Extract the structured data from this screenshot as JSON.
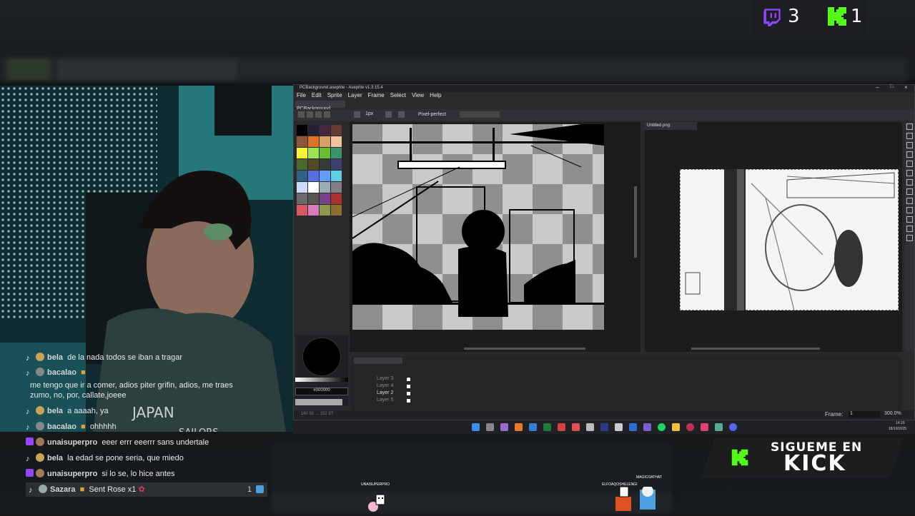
{
  "counters": {
    "twitch": "3",
    "kick": "1"
  },
  "aseprite": {
    "title": "PCBackground.aseprite - Aseprite v1.3.15.4",
    "menu": [
      "File",
      "Edit",
      "Sprite",
      "Layer",
      "Frame",
      "Select",
      "View",
      "Help"
    ],
    "tab_main": "PCBackground.",
    "tab_ref": "Untitled.png",
    "brush_size": "1px",
    "pixel_perfect": "Pixel-perfect",
    "color_hex": "#000000",
    "layers": [
      "Layer 3",
      "Layer 4",
      "Layer 2",
      "Layer 5"
    ],
    "status_coords": "160 91  ...  152 97",
    "frame_label": "Frame:",
    "frame_value": "1",
    "zoom": "300.0%",
    "clock_time": "14:29",
    "clock_date": "18/10/2025"
  },
  "chat": [
    {
      "platform": "tiktok",
      "user": "bela",
      "text": "de la nada todos se iban a tragar"
    },
    {
      "platform": "tiktok",
      "user": "bacalao",
      "text": ""
    },
    {
      "platform": "none",
      "user": "",
      "text": "me tengo que ir a comer, adios piter grifin, adios, me traes"
    },
    {
      "platform": "none",
      "user": "",
      "text": "zumo, no, por, callate,joeee"
    },
    {
      "platform": "tiktok",
      "user": "bela",
      "text": "a aaaah, ya"
    },
    {
      "platform": "tiktok",
      "user": "bacalao",
      "text": "ohhhhh"
    },
    {
      "platform": "twitch",
      "user": "unaisuperpro",
      "text": "eeer errr eeerrr sans undertale"
    },
    {
      "platform": "tiktok",
      "user": "bela",
      "text": "la edad se pone seria, que miedo"
    },
    {
      "platform": "twitch",
      "user": "unaisuperpro",
      "text": "si lo se, lo hice antes"
    },
    {
      "platform": "tiktok",
      "user": "Sazara",
      "text": "Sent Rose x1",
      "gift_count": "1"
    }
  ],
  "overlay": {
    "kick_line1": "SIGUEME EN",
    "kick_line2": "KICK",
    "char1_name": "UNAISUPERPRO",
    "char2_name": "ELFOAQOSHELENGI",
    "char3_name": "MAGICOATHAT"
  },
  "colors": {
    "kick_green": "#53fc18",
    "twitch_purple": "#9146ff",
    "palette": [
      "#000000",
      "#222034",
      "#45283c",
      "#663931",
      "#8f563b",
      "#df7126",
      "#d9a066",
      "#eec39a",
      "#fbf236",
      "#99e550",
      "#6abe30",
      "#37946e",
      "#4b692f",
      "#524b24",
      "#323c39",
      "#3f3f74",
      "#306082",
      "#5b6ee1",
      "#639bff",
      "#5fcde4",
      "#cbdbfc",
      "#ffffff",
      "#9badb7",
      "#847e87",
      "#696a6a",
      "#595652",
      "#76428a",
      "#ac3232",
      "#d95763",
      "#d77bba",
      "#8f974a",
      "#8a6f30"
    ]
  }
}
